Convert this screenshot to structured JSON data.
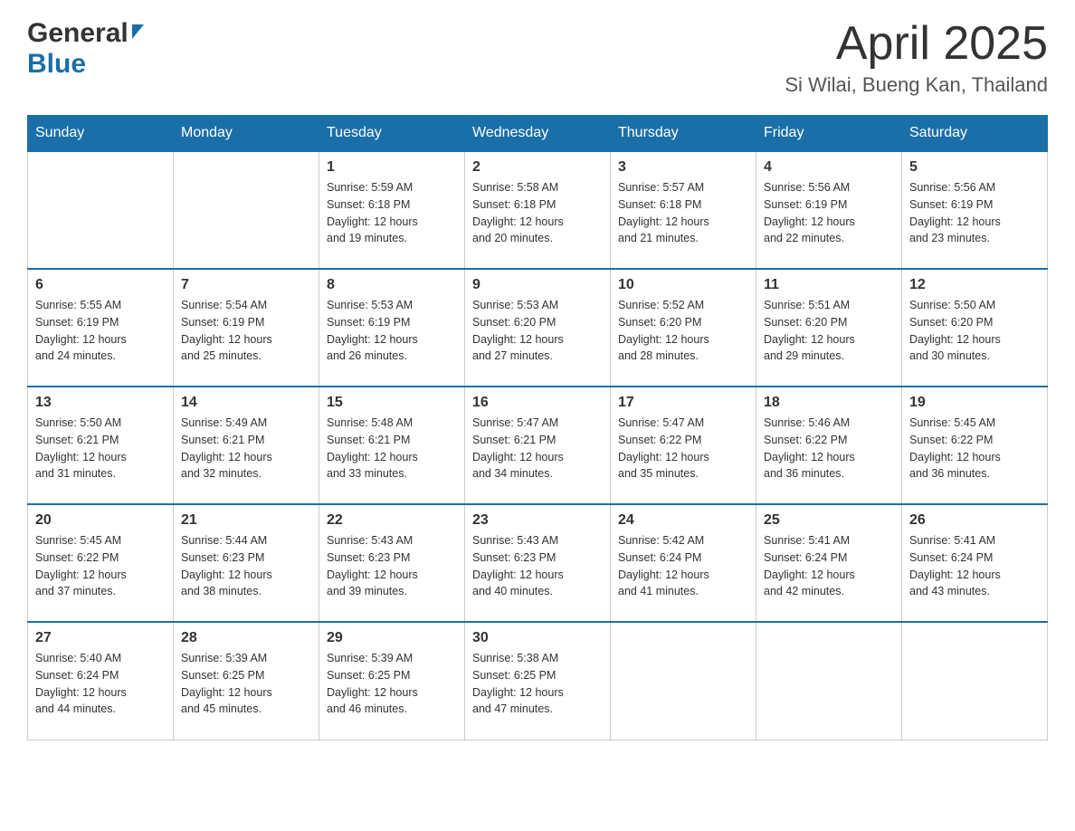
{
  "header": {
    "logo_general": "General",
    "logo_blue": "Blue",
    "month_title": "April 2025",
    "location": "Si Wilai, Bueng Kan, Thailand"
  },
  "days_of_week": [
    "Sunday",
    "Monday",
    "Tuesday",
    "Wednesday",
    "Thursday",
    "Friday",
    "Saturday"
  ],
  "weeks": [
    [
      {
        "day": "",
        "info": ""
      },
      {
        "day": "",
        "info": ""
      },
      {
        "day": "1",
        "info": "Sunrise: 5:59 AM\nSunset: 6:18 PM\nDaylight: 12 hours\nand 19 minutes."
      },
      {
        "day": "2",
        "info": "Sunrise: 5:58 AM\nSunset: 6:18 PM\nDaylight: 12 hours\nand 20 minutes."
      },
      {
        "day": "3",
        "info": "Sunrise: 5:57 AM\nSunset: 6:18 PM\nDaylight: 12 hours\nand 21 minutes."
      },
      {
        "day": "4",
        "info": "Sunrise: 5:56 AM\nSunset: 6:19 PM\nDaylight: 12 hours\nand 22 minutes."
      },
      {
        "day": "5",
        "info": "Sunrise: 5:56 AM\nSunset: 6:19 PM\nDaylight: 12 hours\nand 23 minutes."
      }
    ],
    [
      {
        "day": "6",
        "info": "Sunrise: 5:55 AM\nSunset: 6:19 PM\nDaylight: 12 hours\nand 24 minutes."
      },
      {
        "day": "7",
        "info": "Sunrise: 5:54 AM\nSunset: 6:19 PM\nDaylight: 12 hours\nand 25 minutes."
      },
      {
        "day": "8",
        "info": "Sunrise: 5:53 AM\nSunset: 6:19 PM\nDaylight: 12 hours\nand 26 minutes."
      },
      {
        "day": "9",
        "info": "Sunrise: 5:53 AM\nSunset: 6:20 PM\nDaylight: 12 hours\nand 27 minutes."
      },
      {
        "day": "10",
        "info": "Sunrise: 5:52 AM\nSunset: 6:20 PM\nDaylight: 12 hours\nand 28 minutes."
      },
      {
        "day": "11",
        "info": "Sunrise: 5:51 AM\nSunset: 6:20 PM\nDaylight: 12 hours\nand 29 minutes."
      },
      {
        "day": "12",
        "info": "Sunrise: 5:50 AM\nSunset: 6:20 PM\nDaylight: 12 hours\nand 30 minutes."
      }
    ],
    [
      {
        "day": "13",
        "info": "Sunrise: 5:50 AM\nSunset: 6:21 PM\nDaylight: 12 hours\nand 31 minutes."
      },
      {
        "day": "14",
        "info": "Sunrise: 5:49 AM\nSunset: 6:21 PM\nDaylight: 12 hours\nand 32 minutes."
      },
      {
        "day": "15",
        "info": "Sunrise: 5:48 AM\nSunset: 6:21 PM\nDaylight: 12 hours\nand 33 minutes."
      },
      {
        "day": "16",
        "info": "Sunrise: 5:47 AM\nSunset: 6:21 PM\nDaylight: 12 hours\nand 34 minutes."
      },
      {
        "day": "17",
        "info": "Sunrise: 5:47 AM\nSunset: 6:22 PM\nDaylight: 12 hours\nand 35 minutes."
      },
      {
        "day": "18",
        "info": "Sunrise: 5:46 AM\nSunset: 6:22 PM\nDaylight: 12 hours\nand 36 minutes."
      },
      {
        "day": "19",
        "info": "Sunrise: 5:45 AM\nSunset: 6:22 PM\nDaylight: 12 hours\nand 36 minutes."
      }
    ],
    [
      {
        "day": "20",
        "info": "Sunrise: 5:45 AM\nSunset: 6:22 PM\nDaylight: 12 hours\nand 37 minutes."
      },
      {
        "day": "21",
        "info": "Sunrise: 5:44 AM\nSunset: 6:23 PM\nDaylight: 12 hours\nand 38 minutes."
      },
      {
        "day": "22",
        "info": "Sunrise: 5:43 AM\nSunset: 6:23 PM\nDaylight: 12 hours\nand 39 minutes."
      },
      {
        "day": "23",
        "info": "Sunrise: 5:43 AM\nSunset: 6:23 PM\nDaylight: 12 hours\nand 40 minutes."
      },
      {
        "day": "24",
        "info": "Sunrise: 5:42 AM\nSunset: 6:24 PM\nDaylight: 12 hours\nand 41 minutes."
      },
      {
        "day": "25",
        "info": "Sunrise: 5:41 AM\nSunset: 6:24 PM\nDaylight: 12 hours\nand 42 minutes."
      },
      {
        "day": "26",
        "info": "Sunrise: 5:41 AM\nSunset: 6:24 PM\nDaylight: 12 hours\nand 43 minutes."
      }
    ],
    [
      {
        "day": "27",
        "info": "Sunrise: 5:40 AM\nSunset: 6:24 PM\nDaylight: 12 hours\nand 44 minutes."
      },
      {
        "day": "28",
        "info": "Sunrise: 5:39 AM\nSunset: 6:25 PM\nDaylight: 12 hours\nand 45 minutes."
      },
      {
        "day": "29",
        "info": "Sunrise: 5:39 AM\nSunset: 6:25 PM\nDaylight: 12 hours\nand 46 minutes."
      },
      {
        "day": "30",
        "info": "Sunrise: 5:38 AM\nSunset: 6:25 PM\nDaylight: 12 hours\nand 47 minutes."
      },
      {
        "day": "",
        "info": ""
      },
      {
        "day": "",
        "info": ""
      },
      {
        "day": "",
        "info": ""
      }
    ]
  ]
}
